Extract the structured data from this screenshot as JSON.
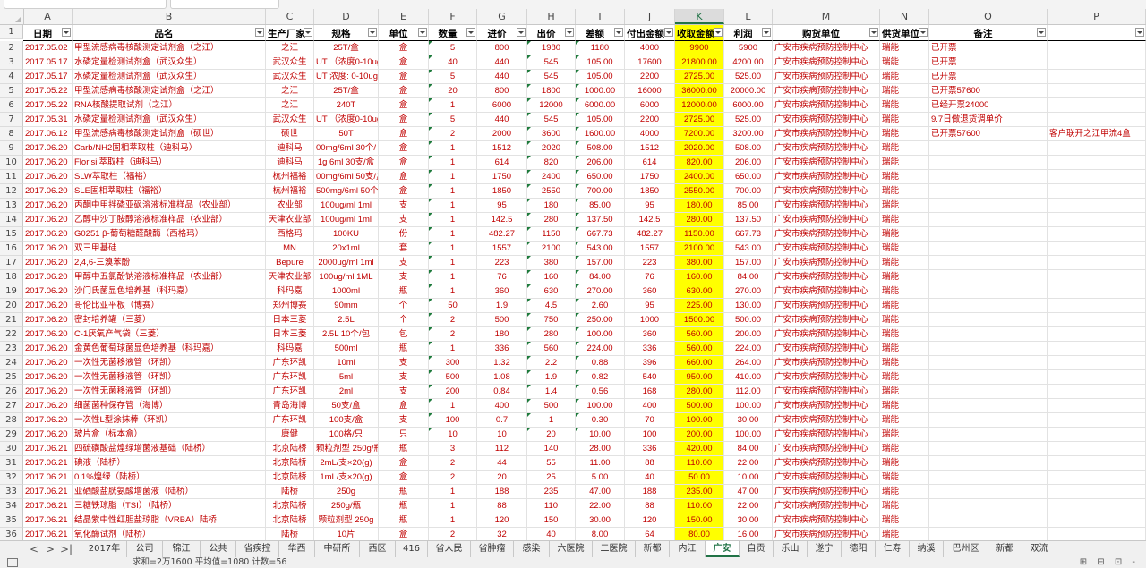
{
  "column_letters": [
    "A",
    "B",
    "C",
    "D",
    "E",
    "F",
    "G",
    "H",
    "I",
    "J",
    "K",
    "L",
    "M",
    "N",
    "O",
    "P"
  ],
  "selected_column": "K",
  "headers": [
    "日期",
    "品名",
    "生产厂家",
    "规格",
    "单位",
    "数量",
    "进价",
    "出价",
    "差额",
    "付出金额",
    "收取金额",
    "利润",
    "购货单位",
    "供货单位",
    "备注",
    ""
  ],
  "rows": [
    [
      "2017.05.02",
      "甲型流感病毒核酸测定试剂盒（之江）",
      "之江",
      "25T/盒",
      "盒",
      "5",
      "800",
      "1980",
      "1180",
      "4000",
      "9900",
      "5900",
      "广安市疾病预防控制中心",
      "瑞能",
      "已开票",
      ""
    ],
    [
      "2017.05.17",
      "水磷定量检测试剂盒（武汉众生）",
      "武汉众生",
      "UT （浓度0-10ug/",
      "盒",
      "40",
      "440",
      "545",
      "105.00",
      "17600",
      "21800.00",
      "4200.00",
      "广安市疾病预防控制中心",
      "瑞能",
      "已开票",
      ""
    ],
    [
      "2017.05.17",
      "水磷定量检测试剂盒（武汉众生）",
      "武汉众生",
      "UT 浓度: 0-10ug",
      "盒",
      "5",
      "440",
      "545",
      "105.00",
      "2200",
      "2725.00",
      "525.00",
      "广安市疾病预防控制中心",
      "瑞能",
      "已开票",
      ""
    ],
    [
      "2017.05.22",
      "甲型流感病毒核酸测定试剂盒（之江）",
      "之江",
      "25T/盒",
      "盒",
      "20",
      "800",
      "1800",
      "1000.00",
      "16000",
      "36000.00",
      "20000.00",
      "广安市疾病预防控制中心",
      "瑞能",
      "已开票57600",
      ""
    ],
    [
      "2017.05.22",
      "RNA核酸提取试剂（之江）",
      "之江",
      "240T",
      "盒",
      "1",
      "6000",
      "12000",
      "6000.00",
      "6000",
      "12000.00",
      "6000.00",
      "广安市疾病预防控制中心",
      "瑞能",
      "已经开票24000",
      ""
    ],
    [
      "2017.05.31",
      "水磷定量检测试剂盒（武汉众生）",
      "武汉众生",
      "UT （浓度0-10ug/",
      "盒",
      "5",
      "440",
      "545",
      "105.00",
      "2200",
      "2725.00",
      "525.00",
      "广安市疾病预防控制中心",
      "瑞能",
      "9.7日做退货调单价",
      ""
    ],
    [
      "2017.06.12",
      "甲型流感病毒核酸测定试剂盒（硕世）",
      "硕世",
      "50T",
      "盒",
      "2",
      "2000",
      "3600",
      "1600.00",
      "4000",
      "7200.00",
      "3200.00",
      "广安市疾病预防控制中心",
      "瑞能",
      "已开票57600",
      "客户联开之江甲流4盒"
    ],
    [
      "2017.06.20",
      "Carb/NH2固相萃取柱（迪科马）",
      "迪科马",
      "00mg/6ml 30个/",
      "盒",
      "1",
      "1512",
      "2020",
      "508.00",
      "1512",
      "2020.00",
      "508.00",
      "广安市疾病预防控制中心",
      "瑞能",
      "",
      ""
    ],
    [
      "2017.06.20",
      "Florisil萃取柱（迪科马）",
      "迪科马",
      "1g 6ml 30支/盒",
      "盒",
      "1",
      "614",
      "820",
      "206.00",
      "614",
      "820.00",
      "206.00",
      "广安市疾病预防控制中心",
      "瑞能",
      "",
      ""
    ],
    [
      "2017.06.20",
      "SLW萃取柱（福裕）",
      "杭州福裕",
      "00mg/6ml 50支/盒",
      "盒",
      "1",
      "1750",
      "2400",
      "650.00",
      "1750",
      "2400.00",
      "650.00",
      "广安市疾病预防控制中心",
      "瑞能",
      "",
      ""
    ],
    [
      "2017.06.20",
      "SLE固相萃取柱（福裕）",
      "杭州福裕",
      "500mg/6ml 50个",
      "盒",
      "1",
      "1850",
      "2550",
      "700.00",
      "1850",
      "2550.00",
      "700.00",
      "广安市疾病预防控制中心",
      "瑞能",
      "",
      ""
    ],
    [
      "2017.06.20",
      "丙酮中甲拌磷亚砜溶液标准样品（农业部）",
      "农业部",
      "100ug/ml 1ml",
      "支",
      "1",
      "95",
      "180",
      "85.00",
      "95",
      "180.00",
      "85.00",
      "广安市疾病预防控制中心",
      "瑞能",
      "",
      ""
    ],
    [
      "2017.06.20",
      "乙醇中沙丁胺醇溶液标准样品（农业部）",
      "天津农业部",
      "100ug/ml 1ml",
      "支",
      "1",
      "142.5",
      "280",
      "137.50",
      "142.5",
      "280.00",
      "137.50",
      "广安市疾病预防控制中心",
      "瑞能",
      "",
      ""
    ],
    [
      "2017.06.20",
      "G0251 β-葡萄糖醛酸酶（西格玛）",
      "西格玛",
      "100KU",
      "份",
      "1",
      "482.27",
      "1150",
      "667.73",
      "482.27",
      "1150.00",
      "667.73",
      "广安市疾病预防控制中心",
      "瑞能",
      "",
      ""
    ],
    [
      "2017.06.20",
      "双三甲基硅",
      "MN",
      "20x1ml",
      "套",
      "1",
      "1557",
      "2100",
      "543.00",
      "1557",
      "2100.00",
      "543.00",
      "广安市疾病预防控制中心",
      "瑞能",
      "",
      ""
    ],
    [
      "2017.06.20",
      "2,4,6-三溴苯酚",
      "Bepure",
      "2000ug/ml 1ml",
      "支",
      "1",
      "223",
      "380",
      "157.00",
      "223",
      "380.00",
      "157.00",
      "广安市疾病预防控制中心",
      "瑞能",
      "",
      ""
    ],
    [
      "2017.06.20",
      "甲醇中五氯酚钠溶液标准样品（农业部）",
      "天津农业部",
      "100ug/ml 1ML",
      "支",
      "1",
      "76",
      "160",
      "84.00",
      "76",
      "160.00",
      "84.00",
      "广安市疾病预防控制中心",
      "瑞能",
      "",
      ""
    ],
    [
      "2017.06.20",
      "沙门氏菌显色培养基（科玛嘉）",
      "科玛嘉",
      "1000ml",
      "瓶",
      "1",
      "360",
      "630",
      "270.00",
      "360",
      "630.00",
      "270.00",
      "广安市疾病预防控制中心",
      "瑞能",
      "",
      ""
    ],
    [
      "2017.06.20",
      "哥伦比亚平板（博赛）",
      "郑州博赛",
      "90mm",
      "个",
      "50",
      "1.9",
      "4.5",
      "2.60",
      "95",
      "225.00",
      "130.00",
      "广安市疾病预防控制中心",
      "瑞能",
      "",
      ""
    ],
    [
      "2017.06.20",
      "密封培养罐（三菱）",
      "日本三菱",
      "2.5L",
      "个",
      "2",
      "500",
      "750",
      "250.00",
      "1000",
      "1500.00",
      "500.00",
      "广安市疾病预防控制中心",
      "瑞能",
      "",
      ""
    ],
    [
      "2017.06.20",
      "C-1厌氧产气袋（三菱）",
      "日本三菱",
      "2.5L 10个/包",
      "包",
      "2",
      "180",
      "280",
      "100.00",
      "360",
      "560.00",
      "200.00",
      "广安市疾病预防控制中心",
      "瑞能",
      "",
      ""
    ],
    [
      "2017.06.20",
      "金黄色葡萄球菌显色培养基（科玛嘉）",
      "科玛嘉",
      "500ml",
      "瓶",
      "1",
      "336",
      "560",
      "224.00",
      "336",
      "560.00",
      "224.00",
      "广安市疾病预防控制中心",
      "瑞能",
      "",
      ""
    ],
    [
      "2017.06.20",
      "一次性无菌移液管（环凯）",
      "广东环凯",
      "10ml",
      "支",
      "300",
      "1.32",
      "2.2",
      "0.88",
      "396",
      "660.00",
      "264.00",
      "广安市疾病预防控制中心",
      "瑞能",
      "",
      ""
    ],
    [
      "2017.06.20",
      "一次性无菌移液管（环凯）",
      "广东环凯",
      "5ml",
      "支",
      "500",
      "1.08",
      "1.9",
      "0.82",
      "540",
      "950.00",
      "410.00",
      "广安市疾病预防控制中心",
      "瑞能",
      "",
      ""
    ],
    [
      "2017.06.20",
      "一次性无菌移液管（环凯）",
      "广东环凯",
      "2ml",
      "支",
      "200",
      "0.84",
      "1.4",
      "0.56",
      "168",
      "280.00",
      "112.00",
      "广安市疾病预防控制中心",
      "瑞能",
      "",
      ""
    ],
    [
      "2017.06.20",
      "细菌菌种保存管（海博）",
      "青岛海博",
      "50支/盒",
      "盒",
      "1",
      "400",
      "500",
      "100.00",
      "400",
      "500.00",
      "100.00",
      "广安市疾病预防控制中心",
      "瑞能",
      "",
      ""
    ],
    [
      "2017.06.20",
      "一次性L型涂抹棒（环凯）",
      "广东环凯",
      "100支/盒",
      "支",
      "100",
      "0.7",
      "1",
      "0.30",
      "70",
      "100.00",
      "30.00",
      "广安市疾病预防控制中心",
      "瑞能",
      "",
      ""
    ],
    [
      "2017.06.20",
      "玻片盒（标本盒）",
      "康健",
      "100格/只",
      "只",
      "10",
      "10",
      "20",
      "10.00",
      "100",
      "200.00",
      "100.00",
      "广安市疾病预防控制中心",
      "瑞能",
      "",
      ""
    ],
    [
      "2017.06.21",
      "四硫磺酸盐煌绿增菌液基础（陆桥）",
      "北京陆桥",
      "颗粒剂型 250g/瓶",
      "瓶",
      "3",
      "112",
      "140",
      "28.00",
      "336",
      "420.00",
      "84.00",
      "广安市疾病预防控制中心",
      "瑞能",
      "",
      ""
    ],
    [
      "2017.06.21",
      "碘液（陆桥）",
      "北京陆桥",
      "2mL/支×20(g)",
      "盒",
      "2",
      "44",
      "55",
      "11.00",
      "88",
      "110.00",
      "22.00",
      "广安市疾病预防控制中心",
      "瑞能",
      "",
      ""
    ],
    [
      "2017.06.21",
      "0.1%煌绿（陆桥）",
      "北京陆桥",
      "1mL/支×20(g)",
      "盒",
      "2",
      "20",
      "25",
      "5.00",
      "40",
      "50.00",
      "10.00",
      "广安市疾病预防控制中心",
      "瑞能",
      "",
      ""
    ],
    [
      "2017.06.21",
      "亚硒酸盐胱氨酸增菌液（陆桥）",
      "陆桥",
      "250g",
      "瓶",
      "1",
      "188",
      "235",
      "47.00",
      "188",
      "235.00",
      "47.00",
      "广安市疾病预防控制中心",
      "瑞能",
      "",
      ""
    ],
    [
      "2017.06.21",
      "三糖铁琼脂（TSI）（陆桥）",
      "北京陆桥",
      "250g/瓶",
      "瓶",
      "1",
      "88",
      "110",
      "22.00",
      "88",
      "110.00",
      "22.00",
      "广安市疾病预防控制中心",
      "瑞能",
      "",
      ""
    ],
    [
      "2017.06.21",
      "结晶紫中性红胆盐琼脂（VRBA）陆桥",
      "北京陆桥",
      "颗粒剂型 250g",
      "瓶",
      "1",
      "120",
      "150",
      "30.00",
      "120",
      "150.00",
      "30.00",
      "广安市疾病预防控制中心",
      "瑞能",
      "",
      ""
    ],
    [
      "2017.06.21",
      "氧化酶试剂（陆桥）",
      "陆桥",
      "10片",
      "盒",
      "2",
      "32",
      "40",
      "8.00",
      "64",
      "80.00",
      "16.00",
      "广安市疾病预防控制中心",
      "瑞能",
      "",
      ""
    ]
  ],
  "sheet_tabs": [
    "2017年",
    "公司",
    "锦江",
    "公共",
    "省疾控",
    "华西",
    "中研所",
    "西区",
    "416",
    "省人民",
    "省肿瘤",
    "感染",
    "六医院",
    "二医院",
    "新都",
    "内江",
    "广安",
    "自贡",
    "乐山",
    "遂宁",
    "德阳",
    "仁寿",
    "纳溪",
    "巴州区",
    "新都",
    "双流"
  ],
  "active_tab": "广安",
  "sheet_nav": [
    "<",
    ">",
    ">|"
  ],
  "status": {
    "stats": "求和=2万1600 平均值=1080 计数=56",
    "views": "⊞ ⊟ ⊡ -"
  },
  "colors": {
    "accent": "#217346",
    "highlight": "#ffff00",
    "cell_text": "#c00000"
  }
}
